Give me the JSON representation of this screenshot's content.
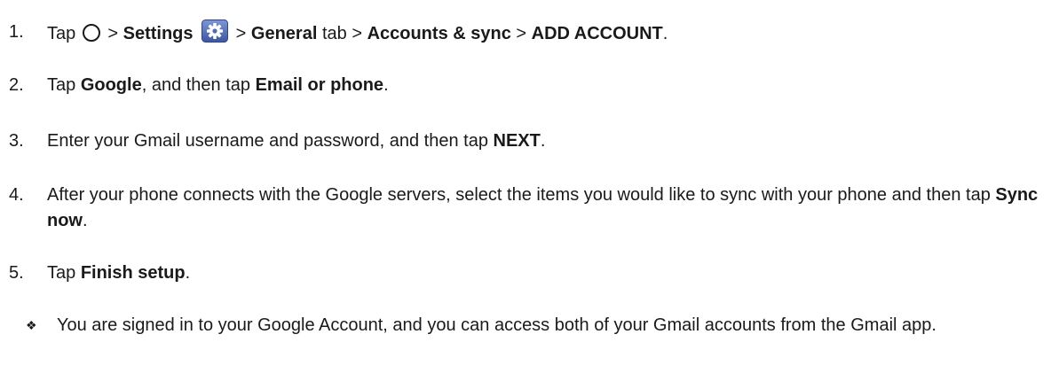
{
  "steps": [
    {
      "number": "1.",
      "parts": {
        "tap": "Tap",
        "sep1": ">",
        "settings": "Settings",
        "sep2": ">",
        "general": "General",
        "tab": "tab >",
        "accounts_sync": "Accounts & sync",
        "sep3": ">",
        "add_account": "ADD ACCOUNT",
        "end": "."
      },
      "icons": [
        "home-circle-icon",
        "settings-gear-icon"
      ]
    },
    {
      "number": "2.",
      "parts": {
        "tap": "Tap",
        "google": "Google",
        "then_tap": ", and then tap",
        "email_or_phone": "Email or phone",
        "end": "."
      }
    },
    {
      "number": "3.",
      "parts": {
        "lead": "Enter your Gmail username and password, and then tap",
        "next": "NEXT",
        "end": "."
      }
    },
    {
      "number": "4.",
      "parts": {
        "lead": "After your phone connects with the Google servers, select the items you would like to sync with your phone and then tap",
        "sync_now": "Sync now",
        "end": "."
      }
    },
    {
      "number": "5.",
      "parts": {
        "tap": "Tap",
        "finish_setup": "Finish setup",
        "end": "."
      }
    }
  ],
  "note": {
    "bullet": "❖",
    "text": "You are signed in to your Google Account, and you can access both of your Gmail accounts from the Gmail app."
  },
  "colors": {
    "text": "#1a1a1a",
    "gear_icon_bg": "#4f6bb5"
  }
}
